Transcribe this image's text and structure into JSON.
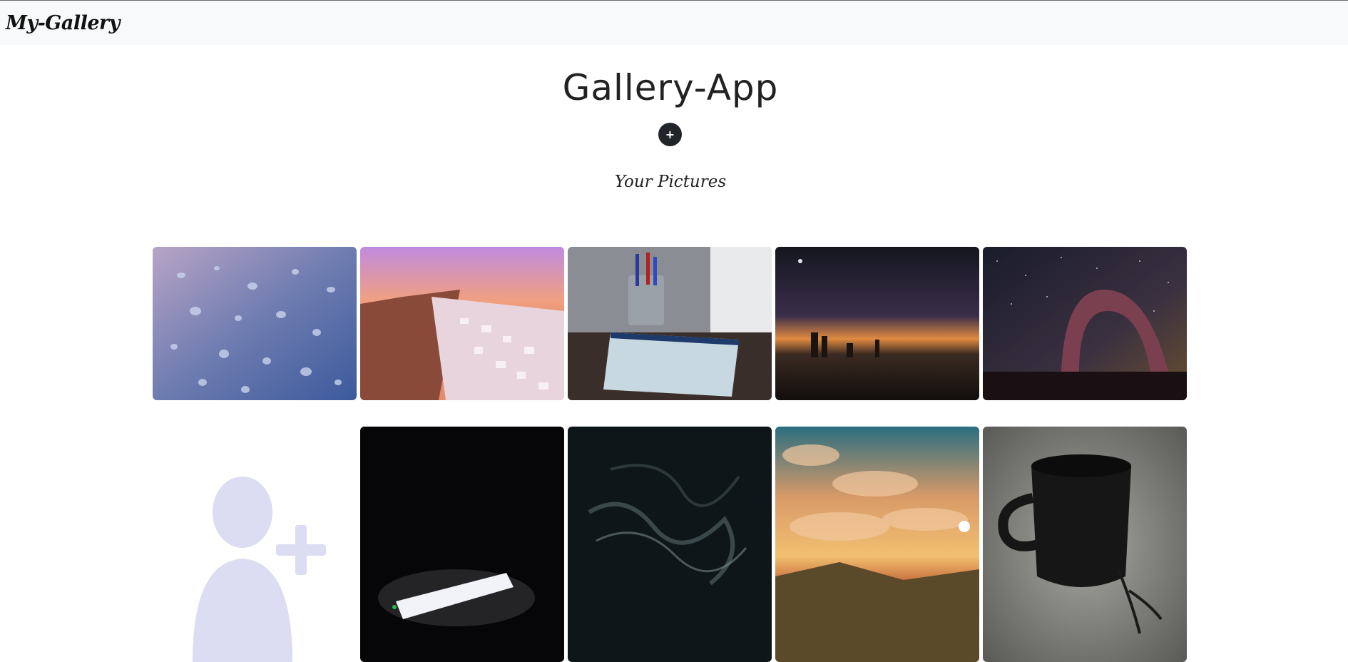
{
  "navbar": {
    "brand": "My-Gallery"
  },
  "header": {
    "title": "Gallery-App",
    "add_button_label": "+"
  },
  "section": {
    "title": "Your Pictures"
  },
  "gallery": {
    "row1": [
      {
        "icon": "water-droplets-image"
      },
      {
        "icon": "santorini-cliff-image"
      },
      {
        "icon": "notebook-pens-image"
      },
      {
        "icon": "city-sunset-fisheye-image"
      },
      {
        "icon": "milky-way-arch-image"
      }
    ],
    "row2": [
      {
        "icon": "add-user-placeholder-icon"
      },
      {
        "icon": "laptop-glow-dark-image"
      },
      {
        "icon": "dark-smoke-abstract-image"
      },
      {
        "icon": "mountain-sky-image"
      },
      {
        "icon": "black-mug-image"
      }
    ]
  },
  "colors": {
    "navbar_bg": "#f8f9fa",
    "button_bg": "#212529",
    "placeholder": "#dcdcf2"
  }
}
